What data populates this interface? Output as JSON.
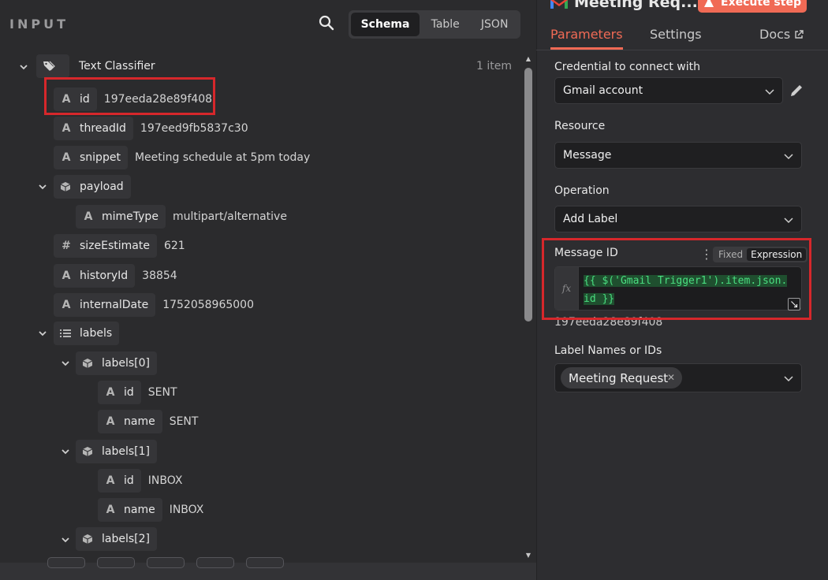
{
  "input_panel": {
    "title": "INPUT",
    "view_tabs": [
      "Schema",
      "Table",
      "JSON"
    ],
    "item_count": "1 item",
    "tree": [
      {
        "key": "Text Classifier",
        "value": "",
        "type": "node"
      },
      {
        "key": "id",
        "value": "197eeda28e89f408",
        "type": "string"
      },
      {
        "key": "threadId",
        "value": "197eed9fb5837c30",
        "type": "string"
      },
      {
        "key": "snippet",
        "value": "Meeting schedule at 5pm today",
        "type": "string"
      },
      {
        "key": "payload",
        "value": "",
        "type": "object"
      },
      {
        "key": "mimeType",
        "value": "multipart/alternative",
        "type": "string"
      },
      {
        "key": "sizeEstimate",
        "value": "621",
        "type": "number"
      },
      {
        "key": "historyId",
        "value": "38854",
        "type": "string"
      },
      {
        "key": "internalDate",
        "value": "1752058965000",
        "type": "string"
      },
      {
        "key": "labels",
        "value": "",
        "type": "array"
      },
      {
        "key": "labels[0]",
        "value": "",
        "type": "object"
      },
      {
        "key": "id",
        "value": "SENT",
        "type": "string"
      },
      {
        "key": "name",
        "value": "SENT",
        "type": "string"
      },
      {
        "key": "labels[1]",
        "value": "",
        "type": "object"
      },
      {
        "key": "id",
        "value": "INBOX",
        "type": "string"
      },
      {
        "key": "name",
        "value": "INBOX",
        "type": "string"
      },
      {
        "key": "labels[2]",
        "value": "",
        "type": "object"
      }
    ]
  },
  "params_panel": {
    "node_title": "Meeting Req...",
    "execute_label": "Execute step",
    "tabs": {
      "parameters": "Parameters",
      "settings": "Settings",
      "docs": "Docs"
    },
    "credential": {
      "label": "Credential to connect with",
      "value": "Gmail account"
    },
    "resource": {
      "label": "Resource",
      "value": "Message"
    },
    "operation": {
      "label": "Operation",
      "value": "Add Label"
    },
    "message_id": {
      "label": "Message ID",
      "mode_fixed": "Fixed",
      "mode_expression": "Expression",
      "fx": "fx",
      "expression_line1": "{{ $('Gmail Trigger1').item.json.",
      "expression_line2": "id }}",
      "preview": "197eeda28e89f408"
    },
    "label_names": {
      "label": "Label Names or IDs",
      "chips": [
        "Meeting Request"
      ]
    }
  },
  "colors": {
    "accent": "#f06a55",
    "highlight": "#d6272b",
    "expression_green": "#4ade80"
  }
}
